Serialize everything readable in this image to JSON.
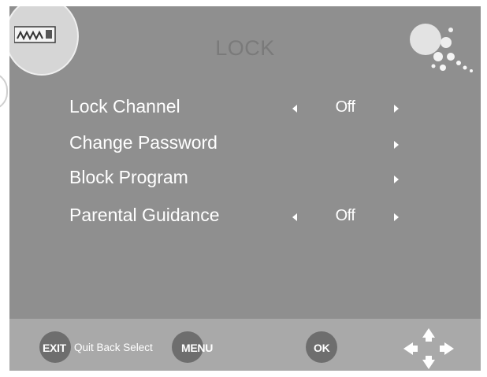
{
  "menu": {
    "title": "LOCK",
    "items": [
      {
        "label": "Lock Channel",
        "value": "Off",
        "has_left_arrow": true,
        "has_right_arrow": true
      },
      {
        "label": "Change Password",
        "value": "",
        "has_left_arrow": false,
        "has_right_arrow": true
      },
      {
        "label": "Block Program",
        "value": "",
        "has_left_arrow": false,
        "has_right_arrow": true
      },
      {
        "label": "Parental Guidance",
        "value": "Off",
        "has_left_arrow": true,
        "has_right_arrow": true
      }
    ]
  },
  "footer": {
    "exit_key": "EXIT",
    "exit_desc": "Quit Back Select",
    "menu_key": "MENU",
    "ok_key": "OK"
  },
  "icons": {
    "badge": "lock-icon",
    "decoration": "bubbles-decoration-icon",
    "nav": "four-way-arrows-icon",
    "arrow_left": "triangle-left-icon",
    "arrow_right": "triangle-right-icon"
  },
  "colors": {
    "panel": "#8f8f8f",
    "footer": "#a9a9a9",
    "title": "#7a7a7a",
    "text": "#ffffff",
    "button": "#6e6e6e"
  }
}
